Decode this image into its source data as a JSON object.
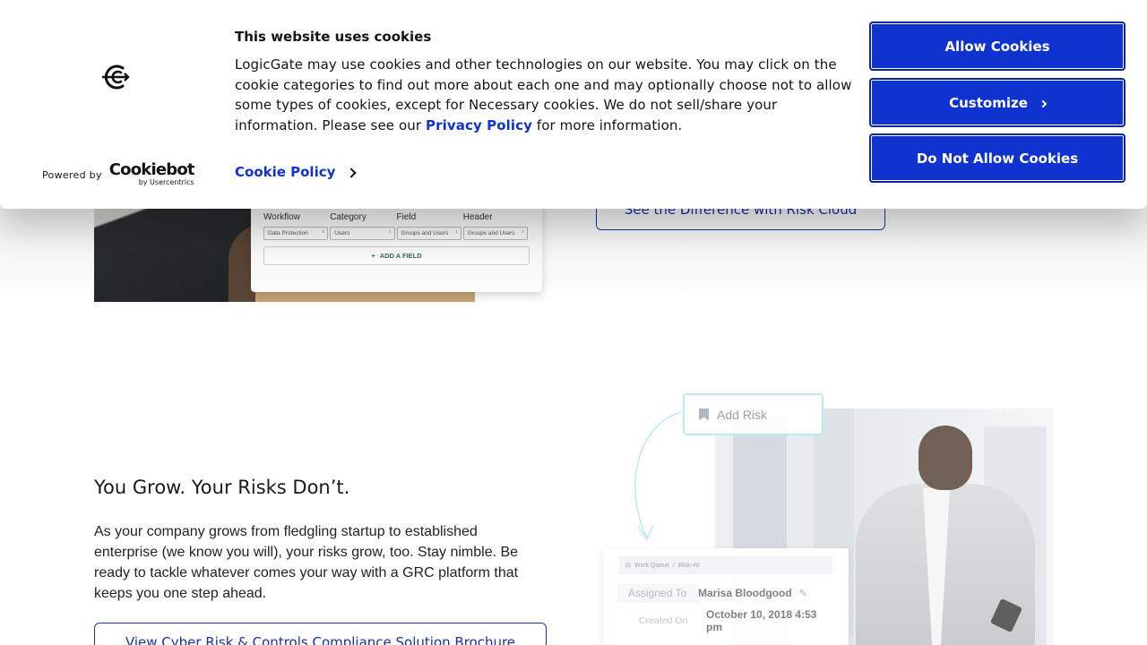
{
  "cookie_banner": {
    "title": "This website uses cookies",
    "body_before_link": "LogicGate may use cookies and other technologies on our website. You may click on the cookie categories to find out more about each one and may optionally choose not to allow some types of cookies, except for Necessary cookies.  We do not sell/share your information. Please see our ",
    "privacy_link": "Privacy Policy",
    "body_after_link": " for more information.",
    "cookie_policy_link": "Cookie Policy",
    "powered_by": "Powered by",
    "cookiebot_brand": "Cookiebot",
    "usercentrics": "by Usercentrics",
    "buttons": {
      "allow": "Allow Cookies",
      "customize": "Customize",
      "deny": "Do Not Allow Cookies"
    },
    "accent_color": "#1032cf"
  },
  "page": {
    "form_card": {
      "columns": [
        {
          "header": "Workflow",
          "value": "Data Protection"
        },
        {
          "header": "Category",
          "value": "Users"
        },
        {
          "header": "Field",
          "value": "Groups and Users"
        },
        {
          "header": "Header",
          "value": "Groups and Users"
        }
      ],
      "add_field": "ADD A FIELD"
    },
    "diff_button": "See the Difference with Risk Cloud",
    "section": {
      "title": "You Grow. Your Risks Don’t.",
      "body": "As your company grows from fledgling startup to established enterprise (we know you will), your risks grow, too. Stay nimble. Be ready to tackle whatever comes your way with a GRC platform that keeps you one step ahead.",
      "brochure_button": "View Cyber Risk & Controls Compliance Solution Brochure"
    },
    "risk_collage": {
      "add_risk": "Add Risk",
      "breadcrumb": [
        "Work Queue",
        "Risk-46"
      ],
      "assigned_label": "Assigned To",
      "assigned_value": "Marisa Bloodgood",
      "created_label": "Created On",
      "created_value": "October 10, 2018 4:53 pm"
    }
  }
}
